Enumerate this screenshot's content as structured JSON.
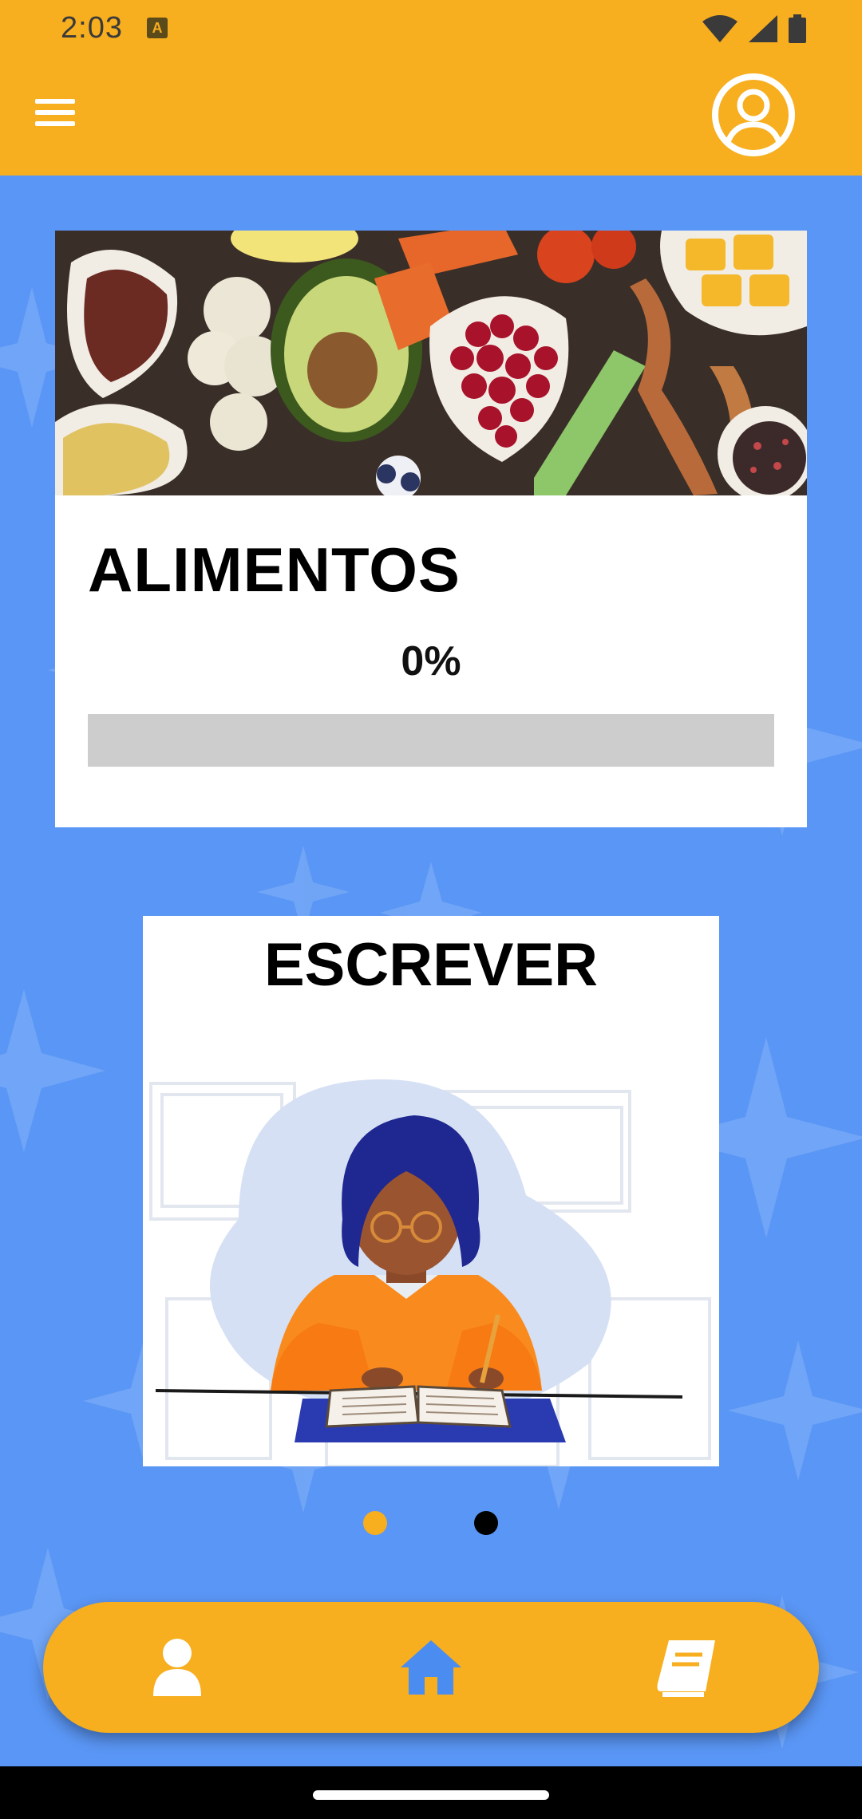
{
  "status_bar": {
    "time": "2:03",
    "notification_icon": "A"
  },
  "app_bar": {
    "menu_icon": "hamburger-icon",
    "profile_icon": "account-circle-icon"
  },
  "cards": [
    {
      "title": "ALIMENTOS",
      "progress_label": "0%",
      "progress_value": 0,
      "image": "vegetables-photo"
    },
    {
      "title": "ESCREVER",
      "image": "student-writing-illustration"
    }
  ],
  "pager": {
    "total": 2,
    "active_index": 0
  },
  "bottom_nav": {
    "items": [
      {
        "icon": "person-icon"
      },
      {
        "icon": "home-icon",
        "active": true
      },
      {
        "icon": "book-icon"
      }
    ]
  },
  "colors": {
    "accent": "#f7ae1f",
    "background": "#5a96f5",
    "active_icon": "#4a8cf0",
    "progress_track": "#cdcdcd"
  }
}
